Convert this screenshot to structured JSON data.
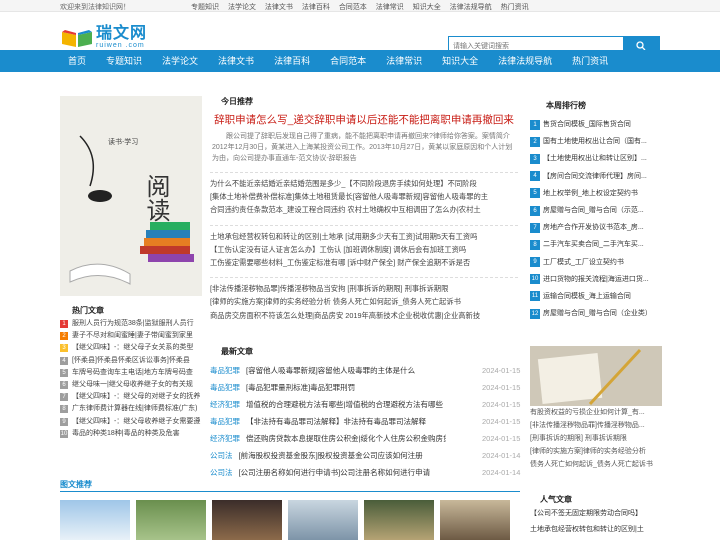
{
  "topbar": {
    "welcome": "欢迎来到法律知识网！",
    "links": [
      "专题知识",
      "法学论文",
      "法律文书",
      "法律百科",
      "合同范本",
      "法律常识",
      "知识大全",
      "法律法规导航",
      "热门资讯"
    ]
  },
  "logo": {
    "cn": "瑞文网",
    "en": "ruiwen .com"
  },
  "search": {
    "placeholder": "请输入关键词搜索"
  },
  "nav": [
    "首页",
    "专题知识",
    "法学论文",
    "法律文书",
    "法律百科",
    "合同范本",
    "法律常识",
    "知识大全",
    "法律法规导航",
    "热门资讯"
  ],
  "banner": {
    "big": "阅读",
    "small": "读书·学习"
  },
  "hot": {
    "title": "热门文章",
    "items": [
      "服刑人员行为规范38条|监狱服刑人员行",
      "妻子不尽对和闺蜜睡|妻子带闺蜜到家里",
      "【继父四味】-：继父母子女关系的类型",
      "[怀柔县]怀柔县怀柔区诉讼事务]怀柔县",
      "车牌号码查询车主电话|地方车牌号码查",
      "继父母味一|继父母收养继子女的有关规",
      "【继父四味】-：继父母的对继子女的抚养",
      "广东律师费计算器在线|律师费标准(广东)",
      "【继父四味】-：继父母收养继子女需要遵",
      "毒品的种类18种|毒品的种类及危害"
    ]
  },
  "today": {
    "title": "今日推荐",
    "lead": "辞职申请怎么写_递交辞职申请以后还能不能把离职申请再撤回来",
    "summary": "跟公司提了辞职后发现自己得了重病，能不能把离职申请再撤回来?律师给你答案。案情简介2012年12月30日，黄某进入上海某投资公司工作。2013年10月27日，黄某以家庭原因和个人计划为由，向公司提办事直通车-范文协议-辞职报告",
    "block1": [
      "为什么不能近亲结婚近亲结婚范围是多少_【不同阶段退房手续如何处理】不同阶段",
      "[集体土地补偿费补偿标准]集体土地租赁最长[容留他人吸毒罪新规]容留他人吸毒罪的主",
      "合同违约责任条款范本_建设工程合同违约 农村土地确权中互相调田了怎么办|农村土"
    ],
    "block2": [
      "土地承包经营权转包和转让的区别|土地承 [试用期多少天有工资]试用期5天有工资吗",
      "【工伤认定没有证人证言怎么办】工伤认 [加班调休制度] 调休后会有加班工资吗",
      "工伤鉴定需要哪些材料_工伤鉴定标准有哪 [诉中财产保全] 财产保全追期不诉是否"
    ],
    "block3": [
      "[非法传播淫秽物品罪]传播淫秽物品当安拘 [刑事拆诉的期限] 刑事拆诉期限",
      "[律师的实施方案]律师的实务经验分析 债务人死亡如何起诉_债务人死亡起诉书",
      "商品房交房面积不符该怎么处理|商品房安 2019年高新技术企业税收优惠|企业高新技"
    ]
  },
  "latest": {
    "title": "最新文章",
    "items": [
      {
        "cat": "毒品犯罪",
        "text": "[容留他人吸毒罪新规]容留他人吸毒罪的主体是什么",
        "date": "2024-01-15"
      },
      {
        "cat": "毒品犯罪",
        "text": "[毒品犯罪量刑标准]毒品犯罪刑罚",
        "date": "2024-01-15"
      },
      {
        "cat": "经济犯罪",
        "text": "增值税的合理避税方法有哪些|增值税的合理避税方法有哪些",
        "date": "2024-01-15"
      },
      {
        "cat": "毒品犯罪",
        "text": "【非法持有毒品罪司法解释】非法持有毒品罪司法解释",
        "date": "2024-01-15"
      },
      {
        "cat": "经济犯罪",
        "text": "偿还购房贷款本息提取住房公积金|绥化个人住房公积金购房贷",
        "date": "2024-01-15"
      },
      {
        "cat": "公司法",
        "text": "[前海股权投资基金股东]股权投资基金公司应该如何注册",
        "date": "2024-01-14"
      },
      {
        "cat": "公司法",
        "text": "[公司注册名称如何进行申请书]公司注册名称如何进行申请",
        "date": "2024-01-14"
      }
    ]
  },
  "rank": {
    "title": "本周排行榜",
    "items": [
      "售货合同模板_国际售货合同",
      "国有土地使用权出让合同（国有...",
      "【土地使用权出让和转让区别】...",
      "【房间合同交流律师代理】房间...",
      "地上权举例_地上权设定契约书",
      "房屋赠与合同_赠与合同（示范...",
      "房地产合作开发协议书范本_房...",
      "二手汽车买卖合同_二手汽车买...",
      "工厂模式_工厂设立契约书",
      "进口货物的报关流程|海运进口货...",
      "运输合同模板_海上运输合同",
      "房屋赠与合同_赠与合同（企业类）"
    ]
  },
  "thumb_caption": [
    "有股资权益的亏损企业如何计算_有...",
    "[非法传播淫秽物品罪]传播淫秽物品...",
    "[刑事拆诉的期限] 刑事拆诉期限",
    "[律师的实施方案]律师的实务经验分析",
    "债务人死亡如何起诉_债务人死亡起诉书"
  ],
  "popular": {
    "title": "人气文章",
    "items": [
      "【公司不签无固定期限劳动合同吗】",
      "土地承包经营权转包和转让的区别|土"
    ]
  },
  "pics": {
    "title": "图文推荐"
  },
  "colors": {
    "brand": "#1a8ccd",
    "lead": "#c81c14"
  }
}
